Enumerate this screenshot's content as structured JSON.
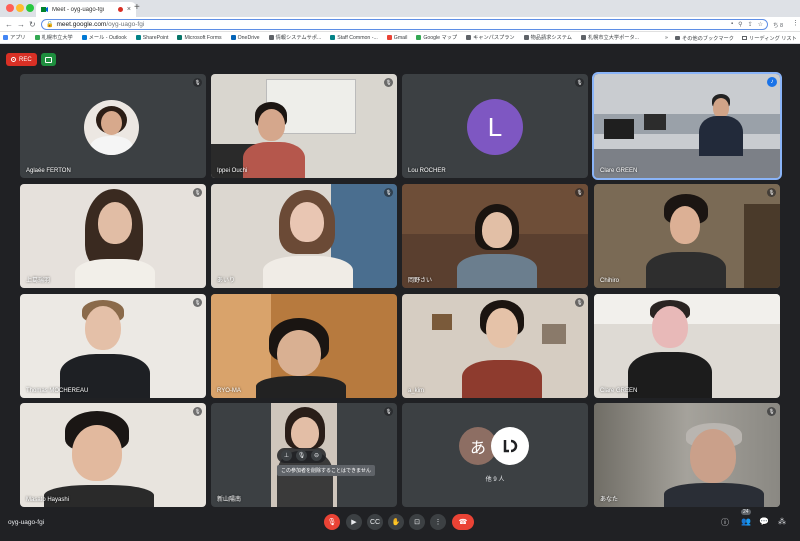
{
  "browser": {
    "tab_title": "Meet - oyg-uago-fgi",
    "tab_close": "×",
    "new_tab": "+",
    "url_host": "meet.google.com",
    "url_path": "/oyg-uago-fgi",
    "toolbar_right_label": "ち 8",
    "bookmarks": [
      {
        "label": "アプリ",
        "color": "#4285f4"
      },
      {
        "label": "札幌市立大学",
        "color": "#34a853"
      },
      {
        "label": "メール - Outlook",
        "color": "#0078d4"
      },
      {
        "label": "SharePoint",
        "color": "#038387"
      },
      {
        "label": "Microsoft Forms",
        "color": "#077568"
      },
      {
        "label": "OneDrive",
        "color": "#0364b8"
      },
      {
        "label": "情報システムサポ...",
        "color": "#5f6368"
      },
      {
        "label": "Staff Common -...",
        "color": "#038387"
      },
      {
        "label": "Gmail",
        "color": "#ea4335"
      },
      {
        "label": "Google マップ",
        "color": "#34a853"
      },
      {
        "label": "キャンパスプラン",
        "color": "#5f6368"
      },
      {
        "label": "物品請求システム",
        "color": "#5f6368"
      },
      {
        "label": "札幌市立大学ポータ...",
        "color": "#5f6368"
      }
    ],
    "bookmarks_overflow": "»",
    "other_bookmarks": "その他のブックマーク",
    "reading_list": "リーディング リスト"
  },
  "meet": {
    "rec_label": "REC",
    "meeting_code": "oyg-uago-fgi",
    "participant_count": "24",
    "others_count_label": "他 9 人",
    "others_avatar_letter": "あ",
    "hover_tooltip": "この参加者を削除することはできません",
    "tiles": [
      {
        "name": "Aglaée FERTON",
        "muted": true
      },
      {
        "name": "Ippei Ouchi",
        "muted": true
      },
      {
        "name": "Lou ROCHER",
        "muted": true,
        "avatar_letter": "L"
      },
      {
        "name": "Clare GREEN",
        "muted": false,
        "speaking": true
      },
      {
        "name": "上葛瑞羽",
        "muted": true
      },
      {
        "name": "あいり",
        "muted": true
      },
      {
        "name": "岡野さい",
        "muted": true
      },
      {
        "name": "Chihiro",
        "muted": true
      },
      {
        "name": "Thomas MOCHEREAU",
        "muted": true
      },
      {
        "name": "RYO-MA",
        "muted": false
      },
      {
        "name": "a_kim",
        "muted": true
      },
      {
        "name": "Clare GREEN",
        "muted": false
      },
      {
        "name": "Masato Hayashi",
        "muted": true
      },
      {
        "name": "新山陽南",
        "muted": true
      },
      {
        "name": "",
        "muted": false
      },
      {
        "name": "あなた",
        "muted": true
      }
    ],
    "icons": {
      "mic_off": "mic-off-icon",
      "speaking": "audio-wave-icon",
      "hangup": "call-end-icon"
    },
    "colors": {
      "accent": "#8ab4f8",
      "rec": "#d93025",
      "hangup": "#ea4335",
      "avatar_purple": "#7e57c2"
    }
  }
}
